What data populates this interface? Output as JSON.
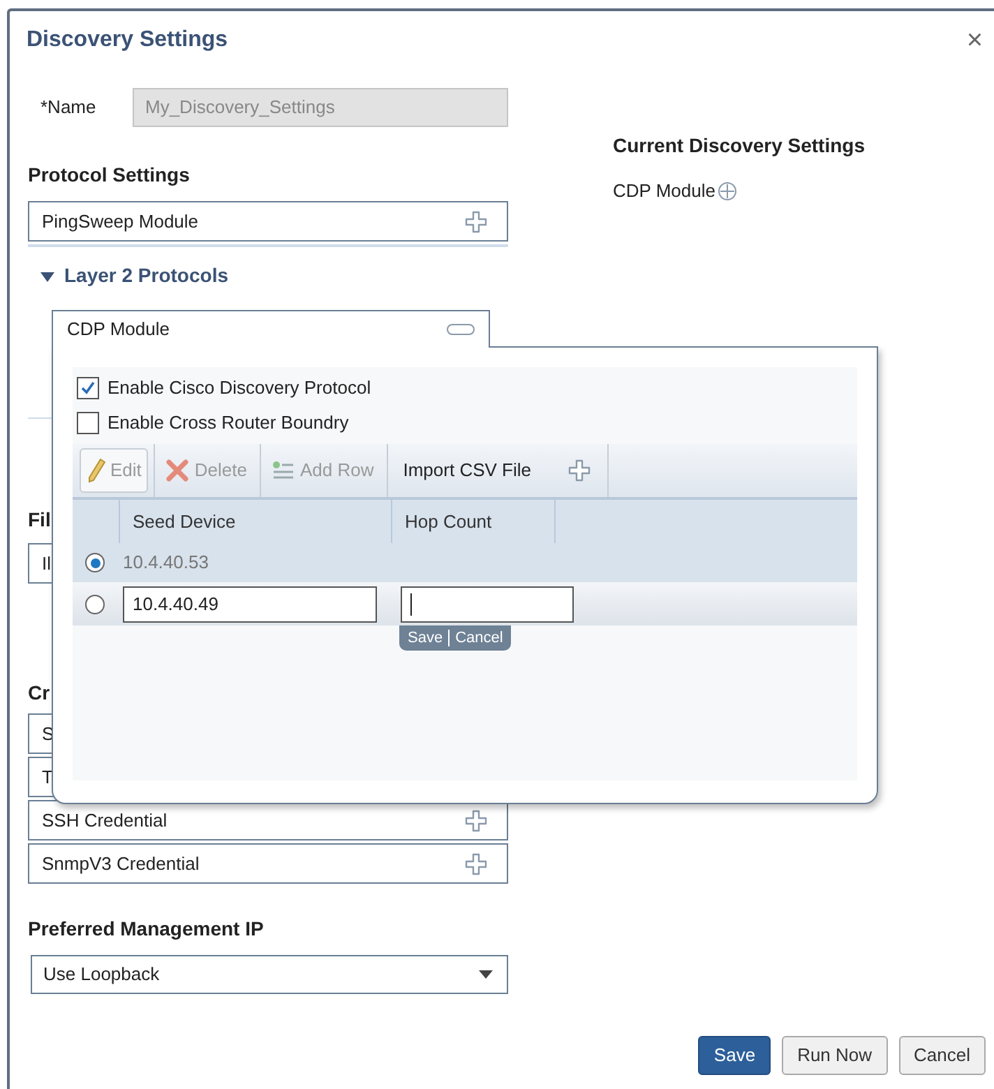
{
  "dialog": {
    "title": "Discovery Settings",
    "close": "×"
  },
  "name_field": {
    "label": "*Name",
    "value": "My_Discovery_Settings",
    "disabled": true
  },
  "current_settings": {
    "heading": "Current Discovery Settings",
    "items": [
      {
        "label": "CDP Module"
      }
    ]
  },
  "protocol_settings": {
    "heading": "Protocol Settings",
    "modules": [
      {
        "label": "PingSweep Module"
      }
    ],
    "group": {
      "label": "Layer 2 Protocols",
      "expanded": true
    }
  },
  "filter_section": {
    "heading": "Fil",
    "value": "Il"
  },
  "credentials": {
    "heading": "Cr",
    "items": [
      {
        "label": "S"
      },
      {
        "label": "T"
      },
      {
        "label": "SSH Credential"
      },
      {
        "label": "SnmpV3 Credential"
      }
    ]
  },
  "management_ip": {
    "heading": "Preferred Management IP",
    "value": "Use Loopback"
  },
  "buttons": [
    {
      "label": "Save",
      "kind": "primary"
    },
    {
      "label": "Run Now",
      "kind": "secondary"
    },
    {
      "label": "Cancel",
      "kind": "secondary"
    }
  ],
  "cdp_popup": {
    "title": "CDP Module",
    "options": [
      {
        "label": "Enable Cisco Discovery Protocol",
        "checked": true
      },
      {
        "label": "Enable Cross Router Boundry",
        "checked": false
      }
    ],
    "toolbar": [
      {
        "label": "Edit",
        "kind": "edit",
        "disabled": true,
        "pressed": true
      },
      {
        "label": "Delete",
        "kind": "delete",
        "disabled": true,
        "pressed": false
      },
      {
        "label": "Add Row",
        "kind": "add",
        "disabled": true,
        "pressed": false
      },
      {
        "label": "Import CSV File",
        "kind": "import",
        "disabled": false,
        "pressed": false
      }
    ],
    "table": {
      "columns": [
        "Seed Device",
        "Hop Count"
      ],
      "rows": [
        {
          "kind": "display",
          "selected": true,
          "seed_device": "10.4.40.53"
        },
        {
          "kind": "edit",
          "selected": false,
          "seed_device": "10.4.40.49",
          "actions": [
            "Save",
            "Cancel"
          ]
        }
      ]
    }
  }
}
